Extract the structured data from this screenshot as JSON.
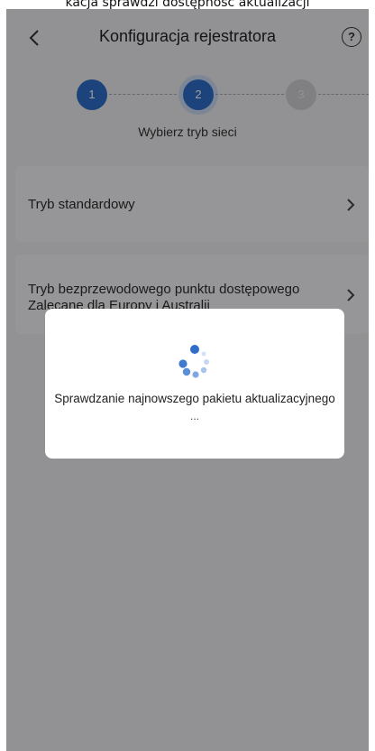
{
  "caption": "kacja sprawdzi dostępność aktualizacji",
  "header": {
    "back_icon": "chevron-left-icon",
    "title": "Konfiguracja rejestratora",
    "help_label": "?"
  },
  "stepper": {
    "steps": [
      {
        "label": "1",
        "state": "done"
      },
      {
        "label": "2",
        "state": "active"
      },
      {
        "label": "3",
        "state": "todo"
      }
    ],
    "caption": "Wybierz tryb sieci"
  },
  "options": [
    {
      "title": "Tryb standardowy",
      "subtitle": ""
    },
    {
      "title": "Tryb bezprzewodowego punktu dostępowego",
      "subtitle": "Zalecane dla Europy i Australii"
    }
  ],
  "dialog": {
    "message": "Sprawdzanie najnowszego pakietu aktualizacyjnego",
    "ellipsis": "..."
  },
  "colors": {
    "accent": "#2f6dc9",
    "overlay": "rgba(0,0,0,0.38)"
  }
}
